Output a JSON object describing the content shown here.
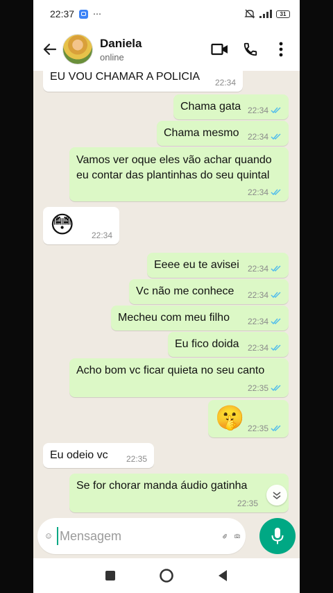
{
  "status_bar": {
    "time": "22:37",
    "more": "⋯",
    "battery": "31"
  },
  "header": {
    "contact_name": "Daniela",
    "contact_status": "online"
  },
  "messages": [
    {
      "dir": "in",
      "text": "EU VOU CHAMAR A POLICIA",
      "time": "22:34"
    },
    {
      "dir": "out",
      "text": "Chama gata",
      "time": "22:34"
    },
    {
      "dir": "out",
      "text": "Chama mesmo",
      "time": "22:34"
    },
    {
      "dir": "out",
      "text": "Vamos ver oque eles vão achar quando\neu contar das plantinhas do seu quintal",
      "time": "22:34"
    },
    {
      "dir": "in",
      "text": "😳",
      "time": "22:34"
    },
    {
      "dir": "out",
      "text": "Eeee eu te avisei",
      "time": "22:34"
    },
    {
      "dir": "out",
      "text": "Vc não me conhece",
      "time": "22:34"
    },
    {
      "dir": "out",
      "text": "Mecheu com meu filho",
      "time": "22:34"
    },
    {
      "dir": "out",
      "text": "Eu fico doida",
      "time": "22:34"
    },
    {
      "dir": "out",
      "text": "Acho bom vc ficar quieta no seu canto",
      "time": "22:35"
    },
    {
      "dir": "out",
      "text": "🤫",
      "time": "22:35"
    },
    {
      "dir": "in",
      "text": "Eu odeio vc",
      "time": "22:35"
    },
    {
      "dir": "out",
      "text": "Se for chorar manda áudio gatinha",
      "time": "22:35"
    }
  ],
  "input": {
    "placeholder": "Mensagem"
  },
  "colors": {
    "accent": "#00a884",
    "outgoing_bubble": "#dcf8c6",
    "incoming_bubble": "#ffffff",
    "chat_background": "#efeae2",
    "read_ticks": "#53bdeb"
  },
  "icons": [
    "back-arrow-icon",
    "video-call-icon",
    "phone-icon",
    "more-vert-icon",
    "emoji-icon",
    "attach-icon",
    "camera-icon",
    "mic-icon",
    "chevron-down-icon",
    "square-icon",
    "circle-icon",
    "triangle-back-icon"
  ]
}
